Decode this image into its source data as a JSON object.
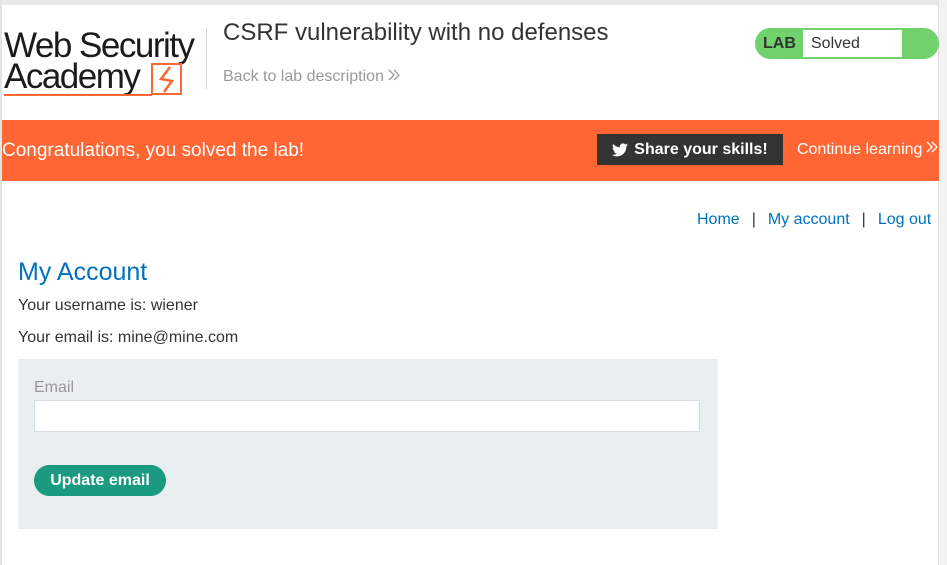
{
  "header": {
    "logo": {
      "line1": "Web Security",
      "line2": "Academy"
    },
    "lab_title": "CSRF vulnerability with no defenses",
    "back_link": "Back to lab description",
    "status": {
      "lab_label": "LAB",
      "state": "Solved",
      "color": "#70d16d"
    }
  },
  "banner": {
    "message": "Congratulations, you solved the lab!",
    "share_label": "Share your skills!",
    "continue_label": "Continue learning",
    "color": "#ff6633"
  },
  "nav": {
    "home": "Home",
    "separator": "|",
    "my_account": "My account",
    "log_out": "Log out"
  },
  "account": {
    "title": "My Account",
    "username_line": "Your username is: wiener",
    "email_line": "Your email is: mine@mine.com",
    "form": {
      "email_label": "Email",
      "email_value": "",
      "submit_label": "Update email"
    }
  },
  "colors": {
    "link": "#0071bc",
    "button": "#1a9b80",
    "panel": "#e9eef1"
  },
  "icons": [
    "logo-bolt-icon",
    "double-chevron-right-icon",
    "twitter-bird-icon"
  ]
}
